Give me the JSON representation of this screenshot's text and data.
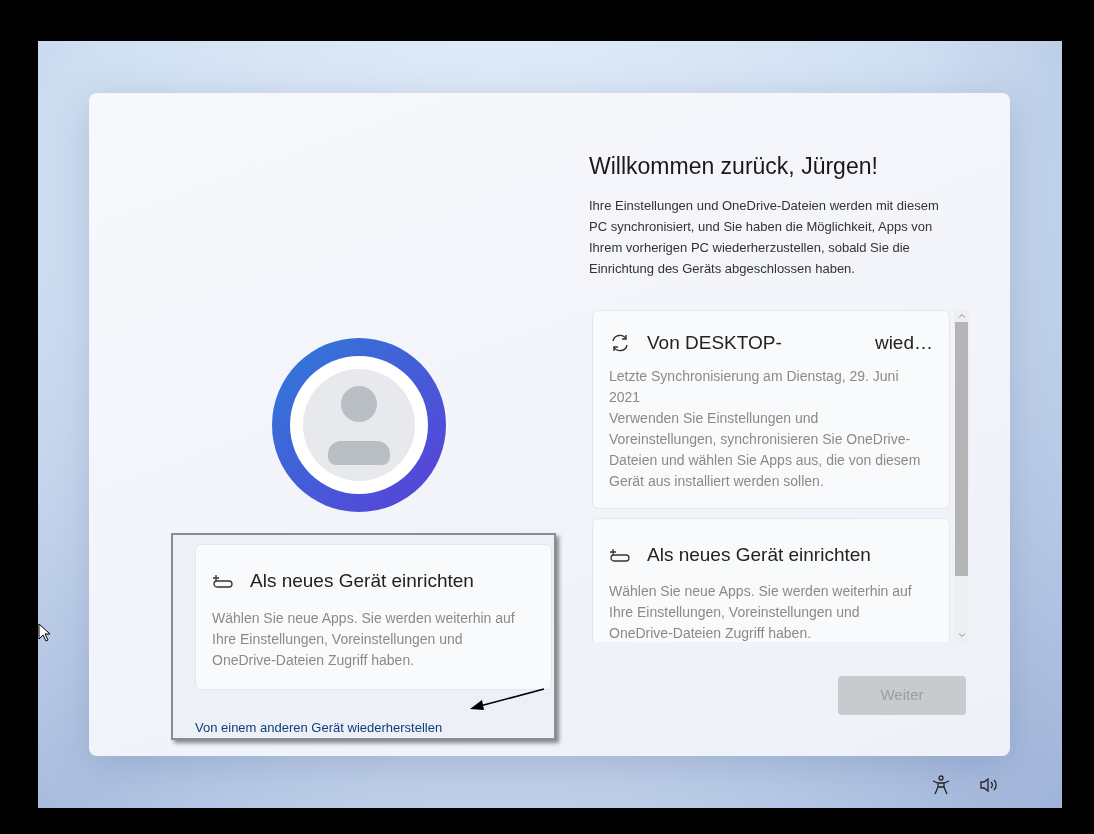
{
  "heading": "Willkommen zurück, Jürgen!",
  "intro": "Ihre Einstellungen und OneDrive-Dateien werden mit diesem PC synchronisiert, und Sie haben die Möglichkeit, Apps von Ihrem vorherigen PC wiederherzustellen, sobald Sie die Einrichtung des Geräts abgeschlossen haben.",
  "options": [
    {
      "kind": "sync",
      "title": "Von DESKTOP-",
      "title_end": "wied…",
      "subtitle": "Letzte Synchronisierung am Dienstag, 29. Juni 2021",
      "description": "Verwenden Sie Einstellungen und Voreinstellungen, synchronisieren Sie OneDrive-Dateien und wählen Sie Apps aus, die von diesem Gerät aus installiert werden sollen."
    },
    {
      "kind": "new",
      "title": "Als neues Gerät einrichten",
      "description": "Wählen Sie neue Apps. Sie werden weiterhin auf Ihre Einstellungen, Voreinstellungen und OneDrive-Dateien Zugriff haben."
    }
  ],
  "next_button": {
    "label": "Weiter",
    "disabled": true
  },
  "callout": {
    "option": {
      "kind": "new",
      "title": "Als neues Gerät einrichten",
      "description": "Wählen Sie neue Apps. Sie werden weiterhin auf Ihre Einstellungen, Voreinstellungen und OneDrive-Dateien Zugriff haben."
    },
    "link": "Von einem anderen Gerät wiederherstellen"
  }
}
